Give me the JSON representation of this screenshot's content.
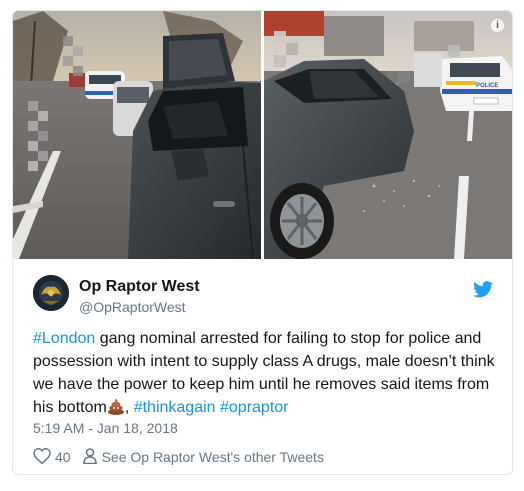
{
  "media": {
    "left_photo_alt": "Grey car with smashed window stopped by police",
    "right_photo_alt": "Grey car and police car on road with broken glass",
    "info_icon": "info-icon",
    "police_text": "POLICE"
  },
  "tweet": {
    "author_name": "Op Raptor West",
    "author_handle": "@OpRaptorWest",
    "text_parts": {
      "hashtag_london": "#London",
      "body": " gang nominal arrested for failing to stop for police and possession with intent to supply class A drugs, male doesn’t think we have the power to keep him until he removes said items from his bottom",
      "separator": ", ",
      "hashtag_thinkagain": "#thinkagain",
      "hashtag_opraptor": "#opraptor"
    },
    "emoji": "pile-of-poo-emoji",
    "timestamp": "5:19 AM - Jan 18, 2018",
    "like_count": "40",
    "other_tweets_link": "See Op Raptor West's other Tweets"
  },
  "colors": {
    "link_blue": "#1b95e0",
    "twitter_blue": "#1da1f2",
    "secondary_text": "#657786",
    "primary_text": "#14171a",
    "border": "#e1e8ed"
  },
  "icons": [
    "twitter-bird-icon",
    "heart-icon",
    "person-icon",
    "info-icon"
  ]
}
